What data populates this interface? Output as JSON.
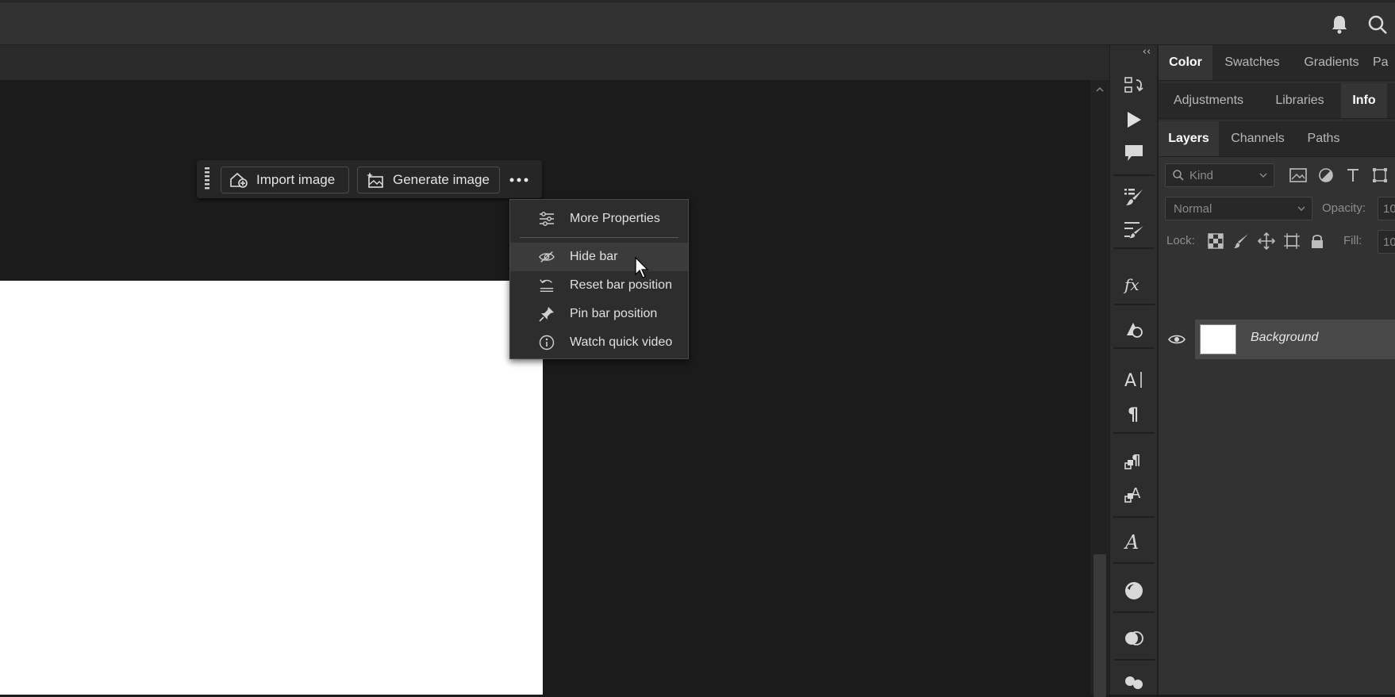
{
  "taskbar": {
    "import_label": "Import image",
    "generate_label": "Generate image"
  },
  "menu": {
    "items": [
      {
        "label": "More Properties",
        "icon": "sliders-icon"
      },
      {
        "label": "Hide bar",
        "icon": "eye-off-icon"
      },
      {
        "label": "Reset bar position",
        "icon": "reset-icon"
      },
      {
        "label": "Pin bar position",
        "icon": "pin-icon"
      },
      {
        "label": "Watch quick video",
        "icon": "info-icon"
      }
    ],
    "hovered": "Hide bar"
  },
  "panels": {
    "row1": [
      "Color",
      "Swatches",
      "Gradients",
      "Pa"
    ],
    "row2": [
      "Adjustments",
      "Libraries",
      "Info"
    ],
    "row3": [
      "Layers",
      "Channels",
      "Paths"
    ],
    "active_row1": "Color",
    "active_row2": "Info",
    "active_row3": "Layers"
  },
  "layers": {
    "filter_placeholder": "Kind",
    "blend_mode": "Normal",
    "opacity_label": "Opacity:",
    "opacity_value": "10",
    "lock_label": "Lock:",
    "fill_label": "Fill:",
    "fill_value": "10",
    "layer_name": "Background"
  },
  "colors": {
    "canvas_bg": "#1b1b1b",
    "document": "#ffffff",
    "panel_bg": "#2e2e2e",
    "active_tab": "#353535"
  }
}
